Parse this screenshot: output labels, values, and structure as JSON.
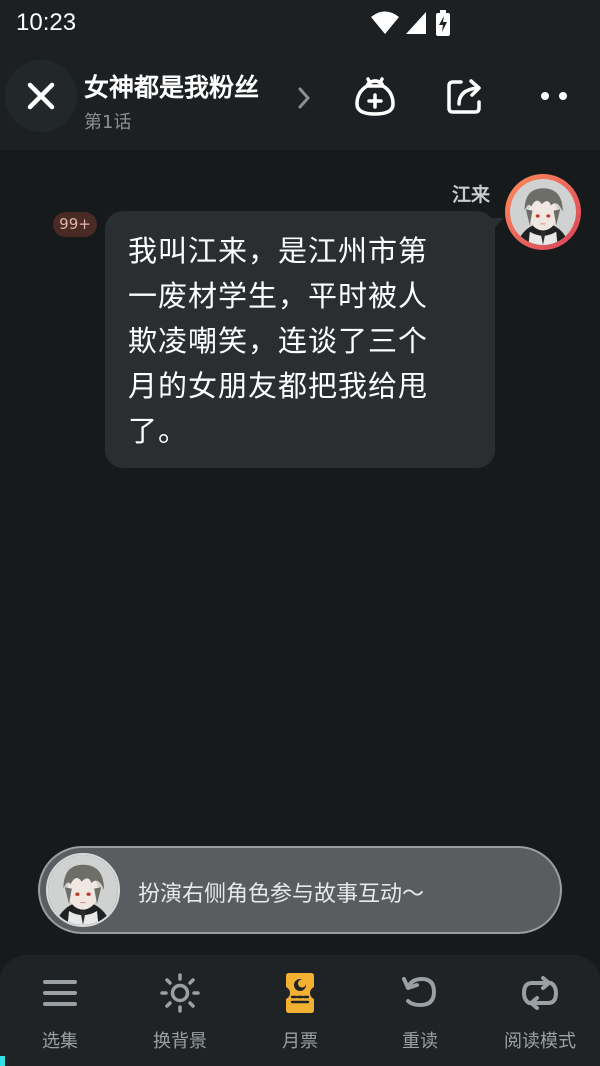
{
  "status_bar": {
    "time": "10:23"
  },
  "header": {
    "title": "女神都是我粉丝",
    "episode": "第1话"
  },
  "chat": {
    "speaker_name": "江来",
    "unread_badge": "99+",
    "message": "我叫江来，是江州市第\n一废材学生，平时被人\n欺凌嘲笑，连谈了三个\n月的女朋友都把我给甩\n了。"
  },
  "roleplay": {
    "prompt": "扮演右侧角色参与故事互动～"
  },
  "bottom_nav": {
    "items": [
      {
        "label": "选集",
        "icon": "list-icon"
      },
      {
        "label": "换背景",
        "icon": "sun-icon"
      },
      {
        "label": "月票",
        "icon": "ticket-icon"
      },
      {
        "label": "重读",
        "icon": "undo-icon"
      },
      {
        "label": "阅读模式",
        "icon": "loop-icon"
      }
    ]
  },
  "colors": {
    "background": "#161a1b",
    "header": "#1c2022",
    "bubble": "#2a2e30",
    "avatar_ring": "#e05a5a",
    "ticket": "#f2b132"
  }
}
